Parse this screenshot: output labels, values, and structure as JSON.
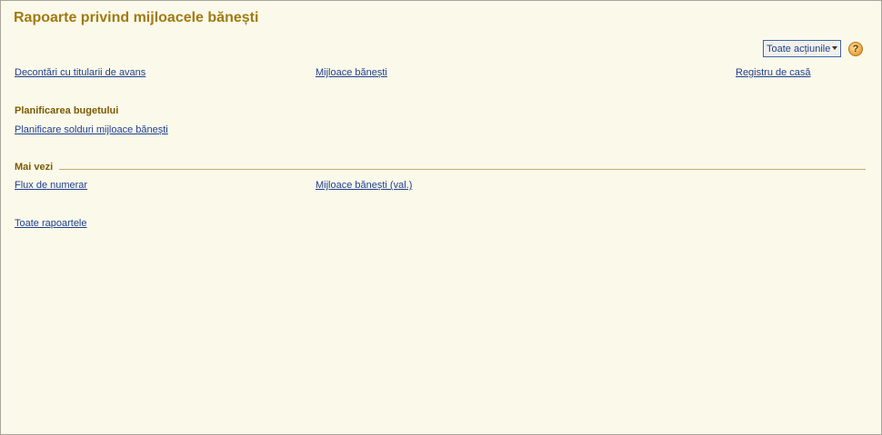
{
  "page": {
    "title": "Rapoarte privind mijloacele bănești"
  },
  "toolbar": {
    "all_actions_label": "Toate acțiunile",
    "help_label": "?"
  },
  "links_top": [
    "Decontări cu titularii de avans",
    "Mijloace bănești",
    "Registru de casă"
  ],
  "budget_section": {
    "title": "Planificarea bugetului",
    "links": [
      "Planificare solduri mijloace bănești"
    ]
  },
  "see_also_section": {
    "title": "Mai vezi",
    "links": [
      "Flux de numerar",
      "Mijloace bănești (val.)"
    ]
  },
  "footer": {
    "all_reports_label": "Toate rapoartele"
  },
  "colors": {
    "background": "#fbf9ea",
    "title": "#a07a10",
    "section_title": "#7a5a00",
    "link": "#1f3f8f",
    "rule": "#c2ad72"
  }
}
